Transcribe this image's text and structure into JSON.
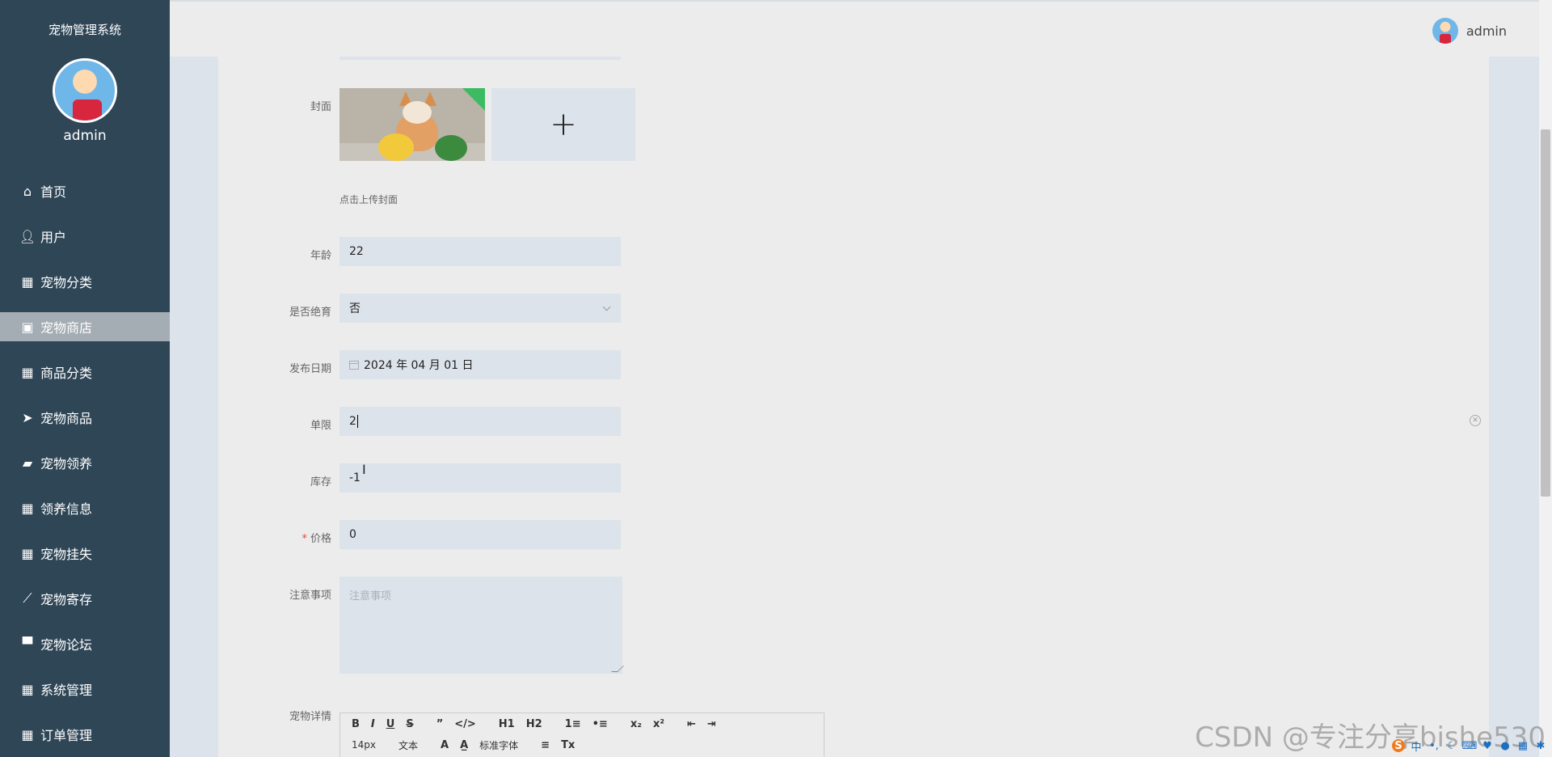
{
  "sidebar": {
    "system_title": "宠物管理系统",
    "username": "admin",
    "items": [
      {
        "label": "首页",
        "icon": "home-icon"
      },
      {
        "label": "用户",
        "icon": "user-icon"
      },
      {
        "label": "宠物分类",
        "icon": "grid-icon"
      },
      {
        "label": "宠物商店",
        "icon": "wallet-icon",
        "active": true
      },
      {
        "label": "商品分类",
        "icon": "grid-icon"
      },
      {
        "label": "宠物商品",
        "icon": "paper-plane-icon"
      },
      {
        "label": "宠物领养",
        "icon": "ticket-icon"
      },
      {
        "label": "领养信息",
        "icon": "grid-icon"
      },
      {
        "label": "宠物挂失",
        "icon": "grid-icon"
      },
      {
        "label": "宠物寄存",
        "icon": "chart-line-icon"
      },
      {
        "label": "宠物论坛",
        "icon": "desktop-icon"
      },
      {
        "label": "系统管理",
        "icon": "grid-icon"
      },
      {
        "label": "订单管理",
        "icon": "grid-icon"
      }
    ]
  },
  "header": {
    "username": "admin"
  },
  "form": {
    "cover": {
      "label": "封面",
      "hint": "点击上传封面",
      "upload_symbol": "+"
    },
    "age": {
      "label": "年龄",
      "value": "22"
    },
    "neutered": {
      "label": "是否绝育",
      "value": "否"
    },
    "publish_date": {
      "label": "发布日期",
      "value": "2024 年 04 月 01 日"
    },
    "limit": {
      "label": "单限",
      "value": "2"
    },
    "stock": {
      "label": "库存",
      "value": "-1"
    },
    "price": {
      "label": "价格",
      "required_mark": "*",
      "value": "0"
    },
    "notes": {
      "label": "注意事项",
      "placeholder": "注意事项"
    },
    "details": {
      "label": "宠物详情"
    }
  },
  "editor": {
    "row1": [
      "B",
      "I",
      "U",
      "S",
      "”",
      "</>",
      "H1",
      "H2",
      "1≡",
      "•≡",
      "x₂",
      "x²",
      "⇤",
      "⇥"
    ],
    "font_size": "14px",
    "block_type": "文本",
    "font_family": "标准字体",
    "row2_icons": [
      "A",
      "A̲",
      "≡",
      "Tx"
    ]
  },
  "watermark": "CSDN @专注分享bishe530",
  "tray": [
    "S",
    "中",
    "•,",
    "☾",
    "⌨",
    "♥",
    "●",
    "▦",
    "✱"
  ],
  "colors": {
    "sidebar_bg": "#2f4657",
    "active_item_bg": "#a4adb3",
    "input_bg": "#dde3ea",
    "corner_tag": "#3dbb62",
    "required": "#e04a3a"
  }
}
